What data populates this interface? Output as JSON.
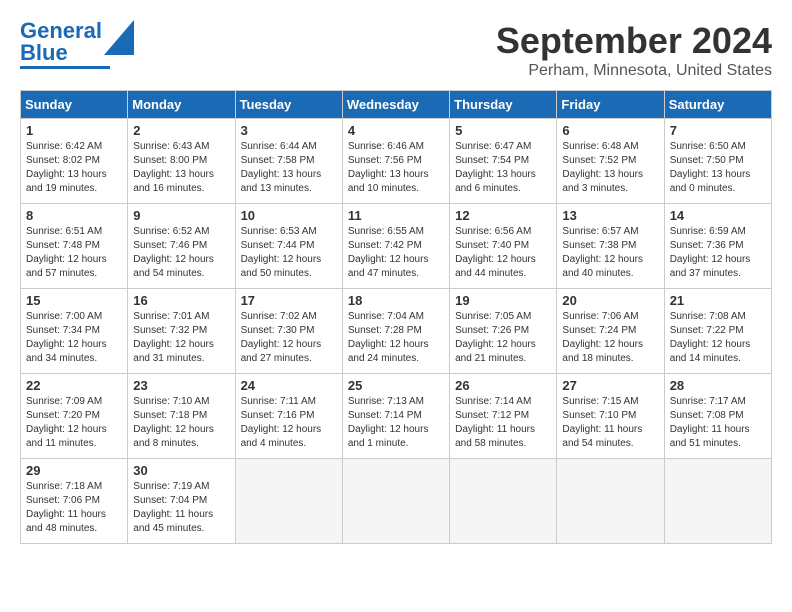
{
  "logo": {
    "line1": "General",
    "line2": "Blue"
  },
  "title": "September 2024",
  "location": "Perham, Minnesota, United States",
  "weekdays": [
    "Sunday",
    "Monday",
    "Tuesday",
    "Wednesday",
    "Thursday",
    "Friday",
    "Saturday"
  ],
  "weeks": [
    [
      {
        "day": 1,
        "info": "Sunrise: 6:42 AM\nSunset: 8:02 PM\nDaylight: 13 hours\nand 19 minutes."
      },
      {
        "day": 2,
        "info": "Sunrise: 6:43 AM\nSunset: 8:00 PM\nDaylight: 13 hours\nand 16 minutes."
      },
      {
        "day": 3,
        "info": "Sunrise: 6:44 AM\nSunset: 7:58 PM\nDaylight: 13 hours\nand 13 minutes."
      },
      {
        "day": 4,
        "info": "Sunrise: 6:46 AM\nSunset: 7:56 PM\nDaylight: 13 hours\nand 10 minutes."
      },
      {
        "day": 5,
        "info": "Sunrise: 6:47 AM\nSunset: 7:54 PM\nDaylight: 13 hours\nand 6 minutes."
      },
      {
        "day": 6,
        "info": "Sunrise: 6:48 AM\nSunset: 7:52 PM\nDaylight: 13 hours\nand 3 minutes."
      },
      {
        "day": 7,
        "info": "Sunrise: 6:50 AM\nSunset: 7:50 PM\nDaylight: 13 hours\nand 0 minutes."
      }
    ],
    [
      {
        "day": 8,
        "info": "Sunrise: 6:51 AM\nSunset: 7:48 PM\nDaylight: 12 hours\nand 57 minutes."
      },
      {
        "day": 9,
        "info": "Sunrise: 6:52 AM\nSunset: 7:46 PM\nDaylight: 12 hours\nand 54 minutes."
      },
      {
        "day": 10,
        "info": "Sunrise: 6:53 AM\nSunset: 7:44 PM\nDaylight: 12 hours\nand 50 minutes."
      },
      {
        "day": 11,
        "info": "Sunrise: 6:55 AM\nSunset: 7:42 PM\nDaylight: 12 hours\nand 47 minutes."
      },
      {
        "day": 12,
        "info": "Sunrise: 6:56 AM\nSunset: 7:40 PM\nDaylight: 12 hours\nand 44 minutes."
      },
      {
        "day": 13,
        "info": "Sunrise: 6:57 AM\nSunset: 7:38 PM\nDaylight: 12 hours\nand 40 minutes."
      },
      {
        "day": 14,
        "info": "Sunrise: 6:59 AM\nSunset: 7:36 PM\nDaylight: 12 hours\nand 37 minutes."
      }
    ],
    [
      {
        "day": 15,
        "info": "Sunrise: 7:00 AM\nSunset: 7:34 PM\nDaylight: 12 hours\nand 34 minutes."
      },
      {
        "day": 16,
        "info": "Sunrise: 7:01 AM\nSunset: 7:32 PM\nDaylight: 12 hours\nand 31 minutes."
      },
      {
        "day": 17,
        "info": "Sunrise: 7:02 AM\nSunset: 7:30 PM\nDaylight: 12 hours\nand 27 minutes."
      },
      {
        "day": 18,
        "info": "Sunrise: 7:04 AM\nSunset: 7:28 PM\nDaylight: 12 hours\nand 24 minutes."
      },
      {
        "day": 19,
        "info": "Sunrise: 7:05 AM\nSunset: 7:26 PM\nDaylight: 12 hours\nand 21 minutes."
      },
      {
        "day": 20,
        "info": "Sunrise: 7:06 AM\nSunset: 7:24 PM\nDaylight: 12 hours\nand 18 minutes."
      },
      {
        "day": 21,
        "info": "Sunrise: 7:08 AM\nSunset: 7:22 PM\nDaylight: 12 hours\nand 14 minutes."
      }
    ],
    [
      {
        "day": 22,
        "info": "Sunrise: 7:09 AM\nSunset: 7:20 PM\nDaylight: 12 hours\nand 11 minutes."
      },
      {
        "day": 23,
        "info": "Sunrise: 7:10 AM\nSunset: 7:18 PM\nDaylight: 12 hours\nand 8 minutes."
      },
      {
        "day": 24,
        "info": "Sunrise: 7:11 AM\nSunset: 7:16 PM\nDaylight: 12 hours\nand 4 minutes."
      },
      {
        "day": 25,
        "info": "Sunrise: 7:13 AM\nSunset: 7:14 PM\nDaylight: 12 hours\nand 1 minute."
      },
      {
        "day": 26,
        "info": "Sunrise: 7:14 AM\nSunset: 7:12 PM\nDaylight: 11 hours\nand 58 minutes."
      },
      {
        "day": 27,
        "info": "Sunrise: 7:15 AM\nSunset: 7:10 PM\nDaylight: 11 hours\nand 54 minutes."
      },
      {
        "day": 28,
        "info": "Sunrise: 7:17 AM\nSunset: 7:08 PM\nDaylight: 11 hours\nand 51 minutes."
      }
    ],
    [
      {
        "day": 29,
        "info": "Sunrise: 7:18 AM\nSunset: 7:06 PM\nDaylight: 11 hours\nand 48 minutes."
      },
      {
        "day": 30,
        "info": "Sunrise: 7:19 AM\nSunset: 7:04 PM\nDaylight: 11 hours\nand 45 minutes."
      },
      null,
      null,
      null,
      null,
      null
    ]
  ]
}
